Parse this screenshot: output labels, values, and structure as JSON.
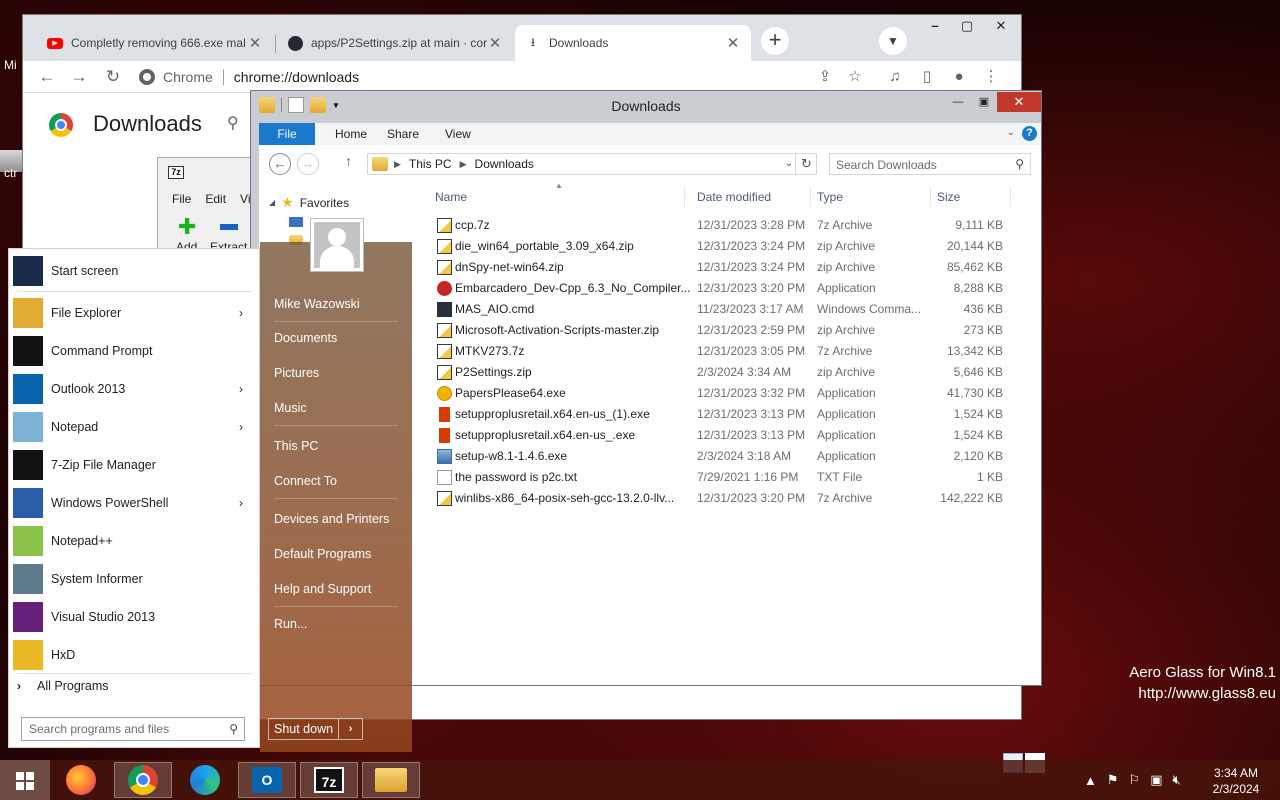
{
  "desktop": {
    "icon_label_1": "Mi",
    "icon_label_2": "ctr",
    "watermark_line1": "Aero Glass for Win8.1",
    "watermark_line2": "http://www.glass8.eu"
  },
  "chrome": {
    "tabs": [
      {
        "label": "Completly removing 666.exe mal",
        "icon": "youtube-icon"
      },
      {
        "label": "apps/P2Settings.zip at main · cor",
        "icon": "github-icon"
      },
      {
        "label": "Downloads",
        "icon": "download-icon"
      }
    ],
    "omnibox_chip": "Chrome",
    "omnibox_url": "chrome://downloads",
    "page_title": "Downloads"
  },
  "sevenzip": {
    "badge": "7z",
    "menu": [
      "File",
      "Edit",
      "Vie"
    ],
    "add_label": "Add",
    "extract_label": "Extract"
  },
  "explorer": {
    "title": "Downloads",
    "ribbon_tabs": [
      "File",
      "Home",
      "Share",
      "View"
    ],
    "help": "?",
    "breadcrumb": [
      "This PC",
      "Downloads"
    ],
    "search_placeholder": "Search Downloads",
    "nav_favorites": "Favorites",
    "columns": {
      "name": "Name",
      "date": "Date modified",
      "type": "Type",
      "size": "Size"
    },
    "files": [
      {
        "name": "ccp.7z",
        "date": "12/31/2023 3:28 PM",
        "type": "7z Archive",
        "size": "9,111 KB",
        "kind": "zip"
      },
      {
        "name": "die_win64_portable_3.09_x64.zip",
        "date": "12/31/2023 3:24 PM",
        "type": "zip Archive",
        "size": "20,144 KB",
        "kind": "zip"
      },
      {
        "name": "dnSpy-net-win64.zip",
        "date": "12/31/2023 3:24 PM",
        "type": "zip Archive",
        "size": "85,462 KB",
        "kind": "zip"
      },
      {
        "name": "Embarcadero_Dev-Cpp_6.3_No_Compiler...",
        "date": "12/31/2023 3:20 PM",
        "type": "Application",
        "size": "8,288 KB",
        "kind": "exe-red"
      },
      {
        "name": "MAS_AIO.cmd",
        "date": "11/23/2023 3:17 AM",
        "type": "Windows Comma...",
        "size": "436 KB",
        "kind": "cmd"
      },
      {
        "name": "Microsoft-Activation-Scripts-master.zip",
        "date": "12/31/2023 2:59 PM",
        "type": "zip Archive",
        "size": "273 KB",
        "kind": "zip"
      },
      {
        "name": "MTKV273.7z",
        "date": "12/31/2023 3:05 PM",
        "type": "7z Archive",
        "size": "13,342 KB",
        "kind": "zip"
      },
      {
        "name": "P2Settings.zip",
        "date": "2/3/2024 3:34 AM",
        "type": "zip Archive",
        "size": "5,646 KB",
        "kind": "zip"
      },
      {
        "name": "PapersPlease64.exe",
        "date": "12/31/2023 3:32 PM",
        "type": "Application",
        "size": "41,730 KB",
        "kind": "pp"
      },
      {
        "name": "setupproplusretail.x64.en-us_(1).exe",
        "date": "12/31/2023 3:13 PM",
        "type": "Application",
        "size": "1,524 KB",
        "kind": "office"
      },
      {
        "name": "setupproplusretail.x64.en-us_.exe",
        "date": "12/31/2023 3:13 PM",
        "type": "Application",
        "size": "1,524 KB",
        "kind": "office"
      },
      {
        "name": "setup-w8.1-1.4.6.exe",
        "date": "2/3/2024 3:18 AM",
        "type": "Application",
        "size": "2,120 KB",
        "kind": "setup"
      },
      {
        "name": "the password is p2c.txt",
        "date": "7/29/2021 1:16 PM",
        "type": "TXT File",
        "size": "1 KB",
        "kind": "txt"
      },
      {
        "name": "winlibs-x86_64-posix-seh-gcc-13.2.0-llv...",
        "date": "12/31/2023 3:20 PM",
        "type": "7z Archive",
        "size": "142,222 KB",
        "kind": "zip"
      }
    ]
  },
  "start_menu": {
    "programs": [
      {
        "label": "Start screen",
        "arrow": false,
        "icon": "start-screen-icon",
        "color": "#1a2a4a"
      },
      {
        "label": "File Explorer",
        "arrow": true,
        "icon": "file-explorer-icon",
        "color": "#e2ab33"
      },
      {
        "label": "Command Prompt",
        "arrow": false,
        "icon": "command-prompt-icon",
        "color": "#111111"
      },
      {
        "label": "Outlook 2013",
        "arrow": true,
        "icon": "outlook-icon",
        "color": "#0a64ad"
      },
      {
        "label": "Notepad",
        "arrow": true,
        "icon": "notepad-icon",
        "color": "#7fb3d5"
      },
      {
        "label": "7-Zip File Manager",
        "arrow": false,
        "icon": "sevenzip-icon",
        "color": "#111111"
      },
      {
        "label": "Windows PowerShell",
        "arrow": true,
        "icon": "powershell-icon",
        "color": "#2a5ea8"
      },
      {
        "label": "Notepad++",
        "arrow": false,
        "icon": "notepadpp-icon",
        "color": "#8bc34a"
      },
      {
        "label": "System Informer",
        "arrow": false,
        "icon": "system-informer-icon",
        "color": "#5f7a8a"
      },
      {
        "label": "Visual Studio 2013",
        "arrow": false,
        "icon": "visual-studio-icon",
        "color": "#68217a"
      },
      {
        "label": "HxD",
        "arrow": false,
        "icon": "hxd-icon",
        "color": "#e8b923"
      }
    ],
    "all_programs": "All Programs",
    "search_placeholder": "Search programs and files",
    "user_name": "Mike Wazowski",
    "right_items": [
      "Documents",
      "Pictures",
      "Music",
      "This PC",
      "Connect To",
      "Devices and Printers",
      "Default Programs",
      "Help and Support",
      "Run..."
    ],
    "shutdown": "Shut down"
  },
  "taskbar": {
    "time": "3:34 AM",
    "date": "2/3/2024"
  }
}
